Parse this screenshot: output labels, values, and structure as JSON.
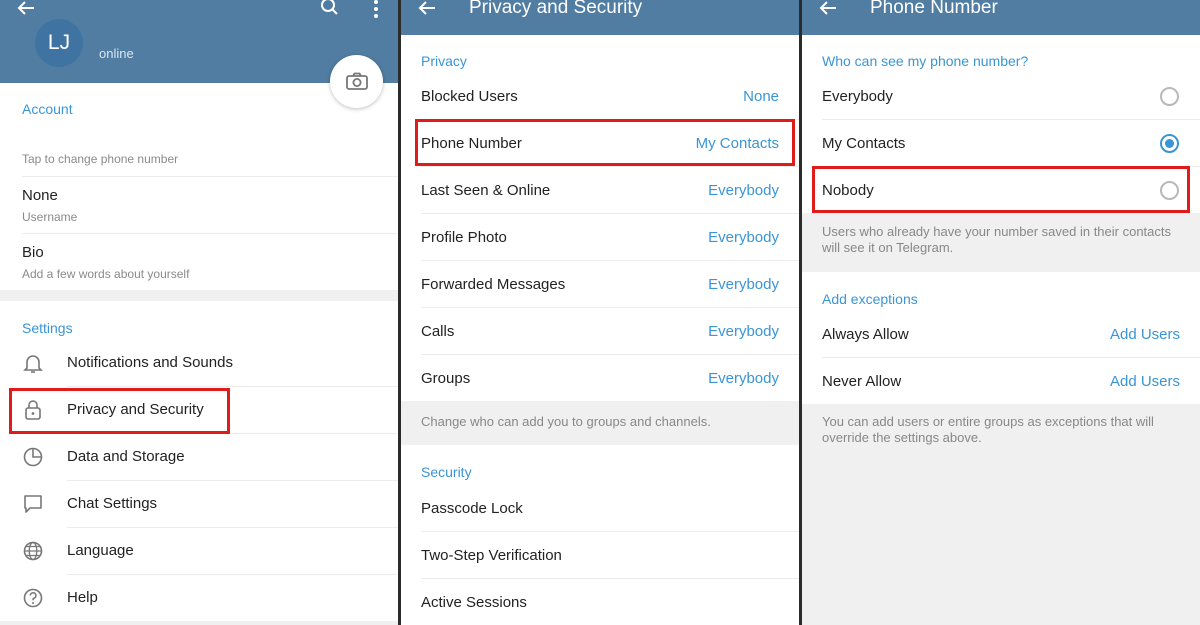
{
  "profile": {
    "initials": "LJ",
    "status": "online",
    "account_header": "Account",
    "phone_hint": "Tap to change phone number",
    "username_value": "None",
    "username_label": "Username",
    "bio_label": "Bio",
    "bio_hint": "Add a few words about yourself",
    "settings_header": "Settings",
    "menu": [
      {
        "label": "Notifications and Sounds",
        "icon": "bell-icon"
      },
      {
        "label": "Privacy and Security",
        "icon": "lock-icon"
      },
      {
        "label": "Data and Storage",
        "icon": "pie-chart-icon"
      },
      {
        "label": "Chat Settings",
        "icon": "chat-bubble-icon"
      },
      {
        "label": "Language",
        "icon": "globe-icon"
      },
      {
        "label": "Help",
        "icon": "help-icon"
      }
    ]
  },
  "privacy": {
    "title": "Privacy and Security",
    "privacy_header": "Privacy",
    "items": [
      {
        "label": "Blocked Users",
        "value": "None"
      },
      {
        "label": "Phone Number",
        "value": "My Contacts"
      },
      {
        "label": "Last Seen & Online",
        "value": "Everybody"
      },
      {
        "label": "Profile Photo",
        "value": "Everybody"
      },
      {
        "label": "Forwarded Messages",
        "value": "Everybody"
      },
      {
        "label": "Calls",
        "value": "Everybody"
      },
      {
        "label": "Groups",
        "value": "Everybody"
      }
    ],
    "groups_hint": "Change who can add you to groups and channels.",
    "security_header": "Security",
    "security_items": [
      "Passcode Lock",
      "Two-Step Verification",
      "Active Sessions"
    ]
  },
  "phone": {
    "title": "Phone Number",
    "question": "Who can see my phone number?",
    "options": [
      {
        "label": "Everybody",
        "selected": false
      },
      {
        "label": "My Contacts",
        "selected": true
      },
      {
        "label": "Nobody",
        "selected": false
      }
    ],
    "hint": "Users who already have your number saved in their contacts will see it on Telegram.",
    "exceptions_header": "Add exceptions",
    "exceptions": [
      {
        "label": "Always Allow",
        "action": "Add Users"
      },
      {
        "label": "Never Allow",
        "action": "Add Users"
      }
    ],
    "exceptions_hint": "You can add users or entire groups as exceptions that will override the settings above."
  },
  "colors": {
    "header": "#517da2",
    "accent": "#3a95d5",
    "highlight": "#e11a1a"
  }
}
